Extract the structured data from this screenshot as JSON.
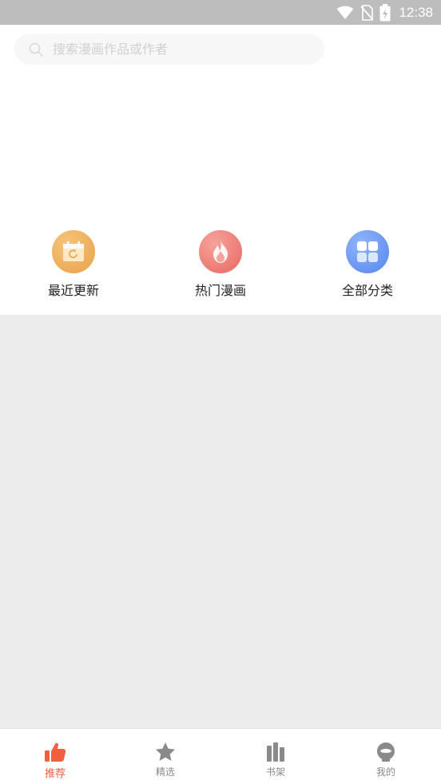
{
  "status_bar": {
    "time": "12:38",
    "icons": [
      "wifi-icon",
      "no-sim-icon",
      "battery-charging-icon"
    ]
  },
  "search": {
    "placeholder": "搜索漫画作品或作者"
  },
  "quick_links": [
    {
      "label": "最近更新",
      "icon": "calendar-refresh-icon",
      "color": "#eda94f"
    },
    {
      "label": "热门漫画",
      "icon": "flame-icon",
      "color": "#ec6d6a"
    },
    {
      "label": "全部分类",
      "icon": "grid-icon",
      "color": "#5b8ff0"
    }
  ],
  "tabs": [
    {
      "label": "推荐",
      "icon": "thumbs-up-icon",
      "active": true
    },
    {
      "label": "精选",
      "icon": "star-icon",
      "active": false
    },
    {
      "label": "书架",
      "icon": "bookshelf-icon",
      "active": false
    },
    {
      "label": "我的",
      "icon": "profile-icon",
      "active": false
    }
  ],
  "colors": {
    "accent": "#f0603e",
    "status_bar": "#bdbdbd",
    "content_bg": "#ececec",
    "inactive_tab": "#8a8a8a"
  }
}
